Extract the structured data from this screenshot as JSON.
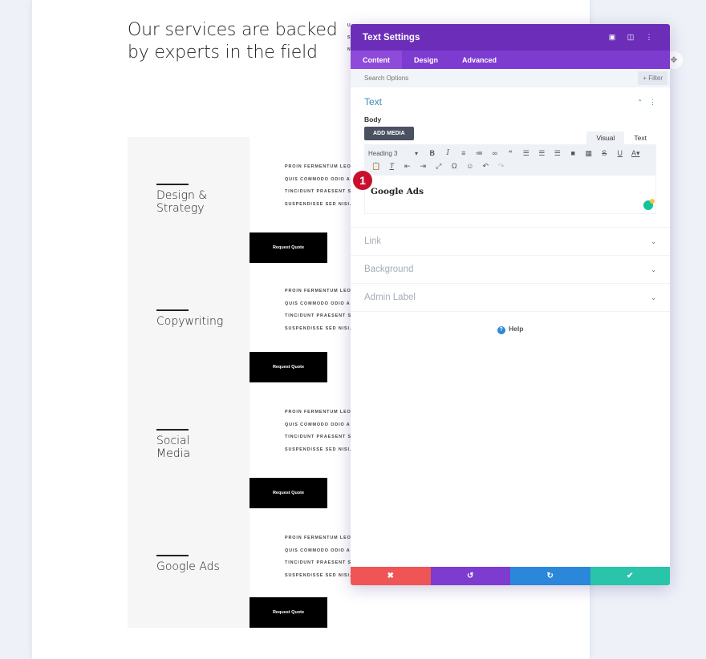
{
  "page": {
    "headline": [
      "Our services are backed",
      "by experts in the field"
    ],
    "peek_letters": [
      "U",
      "S",
      "N"
    ],
    "services": [
      {
        "title": "Design &\nStrategy",
        "list": [
          "PROIN FERMENTUM LEO VE",
          "QUIS COMMODO ODIO AEN",
          "TINCIDUNT PRAESENT SEM",
          "SUSPENDISSE SED NISI. PL"
        ],
        "button": "Request Quote"
      },
      {
        "title": "Copywriting",
        "list": [
          "PROIN FERMENTUM LEO VE",
          "QUIS COMMODO ODIO AEN",
          "TINCIDUNT PRAESENT SEM",
          "SUSPENDISSE SED NISI. PL"
        ],
        "button": "Request Quote"
      },
      {
        "title": "Social\nMedia",
        "list": [
          "PROIN FERMENTUM LEO VE",
          "QUIS COMMODO ODIO AEN",
          "TINCIDUNT PRAESENT SEM",
          "SUSPENDISSE SED NISI. PL"
        ],
        "button": "Request Quote"
      },
      {
        "title": "Google Ads",
        "list": [
          "PROIN FERMENTUM LEO VE",
          "QUIS COMMODO ODIO AEN",
          "TINCIDUNT PRAESENT SEM",
          "SUSPENDISSE SED NISI. PL"
        ],
        "button": "Request Quote"
      }
    ]
  },
  "modal": {
    "title": "Text Settings",
    "header_icons": [
      "fullscreen-icon",
      "split-view-icon",
      "more-options-icon"
    ],
    "tabs": [
      {
        "label": "Content",
        "active": true
      },
      {
        "label": "Design",
        "active": false
      },
      {
        "label": "Advanced",
        "active": false
      }
    ],
    "search_placeholder": "Search Options",
    "filter_label": "+ Filter",
    "text_section": {
      "title": "Text",
      "body_label": "Body",
      "add_media": "ADD MEDIA",
      "editor_tabs": [
        "Visual",
        "Text"
      ],
      "format_select": "Heading 3",
      "content": "Google Ads"
    },
    "badge_number": "1",
    "closed_sections": [
      "Link",
      "Background",
      "Admin Label"
    ],
    "help_label": "Help",
    "footer": {
      "colors": [
        "#ef5555",
        "#7d3bcf",
        "#2b87da",
        "#29c4a9"
      ],
      "actions": [
        "discard",
        "undo",
        "redo",
        "save"
      ]
    }
  }
}
